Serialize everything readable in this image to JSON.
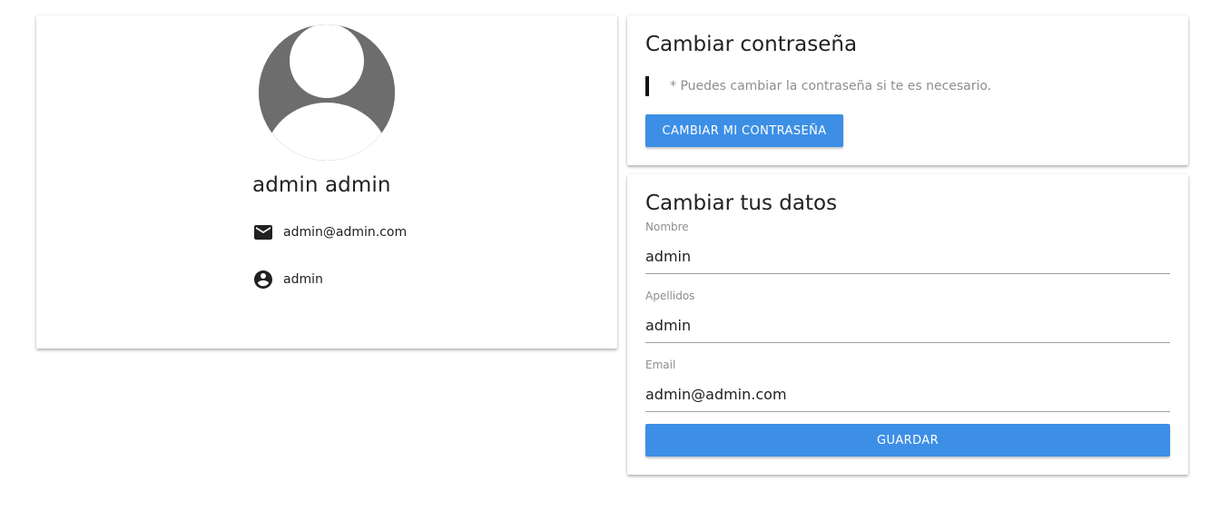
{
  "profile": {
    "name": "admin admin",
    "email": "admin@admin.com",
    "username": "admin",
    "avatar_icon": "default-user-avatar",
    "email_icon": "mail-icon",
    "user_icon": "account-circle-icon"
  },
  "password_section": {
    "title": "Cambiar contraseña",
    "note": "* Puedes cambiar la contraseña si te es necesario.",
    "button_label": "CAMBIAR MI CONTRASEÑA"
  },
  "data_section": {
    "title": "Cambiar tus datos",
    "fields": [
      {
        "label": "Nombre",
        "value": "admin"
      },
      {
        "label": "Apellidos",
        "value": "admin"
      },
      {
        "label": "Email",
        "value": "admin@admin.com"
      }
    ],
    "save_label": "GUARDAR"
  },
  "colors": {
    "primary_button": "#3d8fe6",
    "avatar_gray": "#6d6d6d",
    "muted_text": "#8e8e8e"
  }
}
